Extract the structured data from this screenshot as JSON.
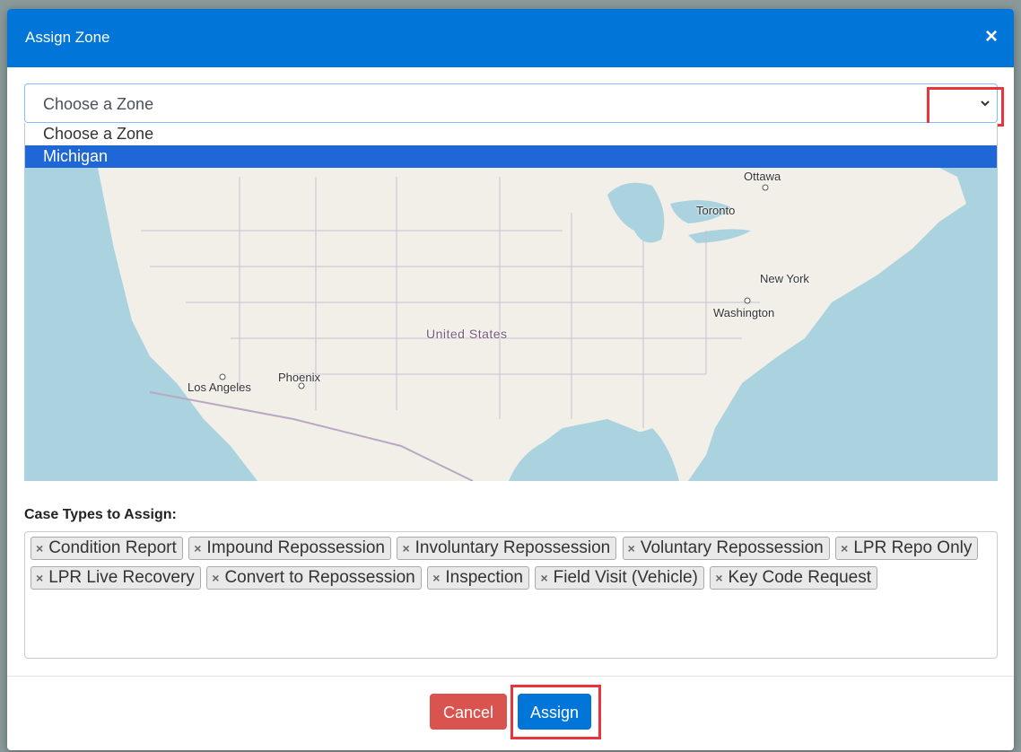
{
  "modal": {
    "title": "Assign Zone",
    "close_label": "×"
  },
  "zone_select": {
    "value": "Choose a Zone",
    "options": [
      "Choose a Zone",
      "Michigan"
    ],
    "highlighted_option": "Michigan"
  },
  "map": {
    "labels": {
      "ottawa": "Ottawa",
      "toronto": "Toronto",
      "new_york": "New York",
      "washington": "Washington",
      "united_states": "United States",
      "phoenix": "Phoenix",
      "los_angeles": "Los Angeles"
    },
    "colors": {
      "water": "#aad3df",
      "land": "#f2efe9",
      "border": "#b9a8c2"
    }
  },
  "case_types": {
    "label": "Case Types to Assign:",
    "tags": [
      "Condition Report",
      "Impound Repossession",
      "Involuntary Repossession",
      "Voluntary Repossession",
      "LPR Repo Only",
      "LPR Live Recovery",
      "Convert to Repossession",
      "Inspection",
      "Field Visit (Vehicle)",
      "Key Code Request"
    ],
    "remove_glyph": "×"
  },
  "footer": {
    "cancel_label": "Cancel",
    "assign_label": "Assign"
  },
  "colors": {
    "header": "#0275d8",
    "cancel": "#d9534f",
    "assign": "#0275d8",
    "highlight": "#e8353b"
  }
}
